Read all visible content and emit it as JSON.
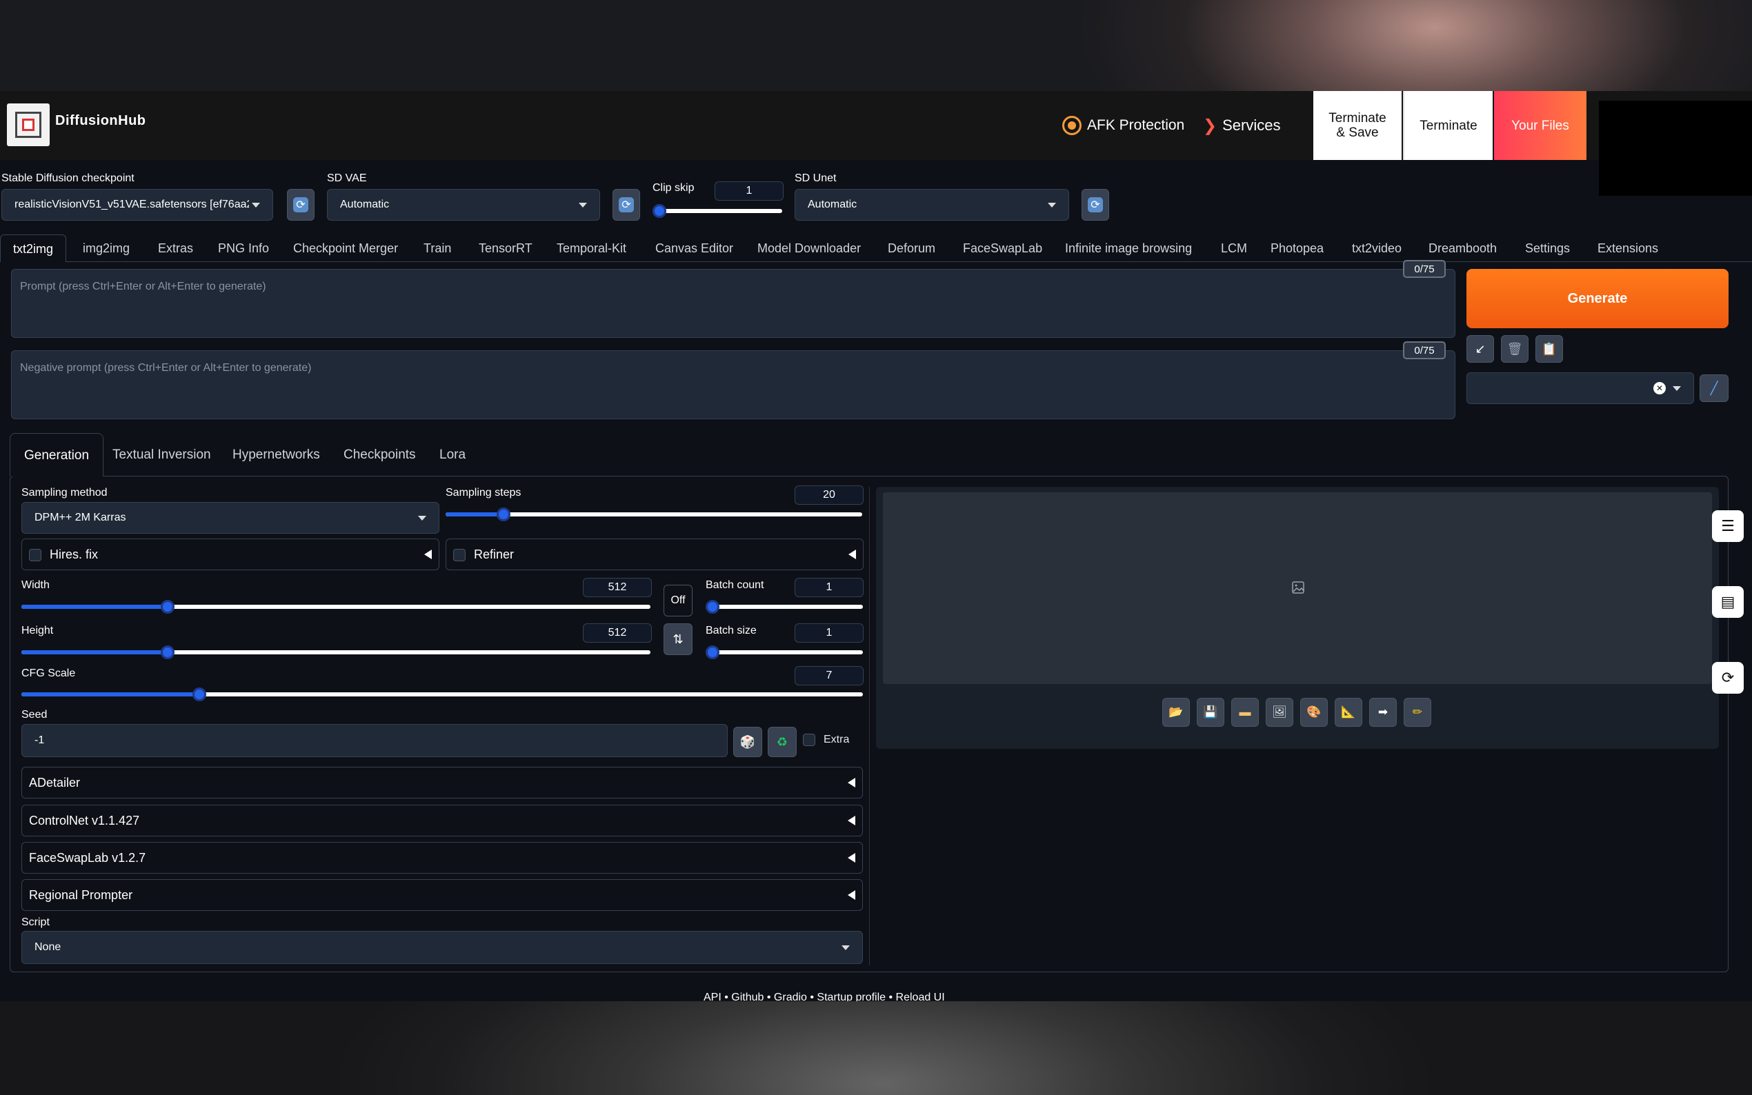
{
  "header": {
    "brand": "DiffusionHub",
    "afk_label": "AFK Protection",
    "services_label": "Services",
    "terminate_save_label": "Terminate & Save",
    "terminate_label": "Terminate",
    "your_files_label": "Your Files"
  },
  "settings": {
    "checkpoint_label": "Stable Diffusion checkpoint",
    "checkpoint_value": "realisticVisionV51_v51VAE.safetensors [ef76aa2",
    "vae_label": "SD VAE",
    "vae_value": "Automatic",
    "clip_skip_label": "Clip skip",
    "clip_skip_value": "1",
    "unet_label": "SD Unet",
    "unet_value": "Automatic"
  },
  "tabs": [
    "txt2img",
    "img2img",
    "Extras",
    "PNG Info",
    "Checkpoint Merger",
    "Train",
    "TensorRT",
    "Temporal-Kit",
    "Canvas Editor",
    "Model Downloader",
    "Deforum",
    "FaceSwapLab",
    "Infinite image browsing",
    "LCM",
    "Photopea",
    "txt2video",
    "Dreambooth",
    "Settings",
    "Extensions"
  ],
  "prompt": {
    "placeholder": "Prompt (press Ctrl+Enter or Alt+Enter to generate)",
    "counter": "0/75",
    "negative_placeholder": "Negative prompt (press Ctrl+Enter or Alt+Enter to generate)",
    "negative_counter": "0/75"
  },
  "generate_label": "Generate",
  "subtabs": [
    "Generation",
    "Textual Inversion",
    "Hypernetworks",
    "Checkpoints",
    "Lora"
  ],
  "generation": {
    "sampling_method_label": "Sampling method",
    "sampling_method_value": "DPM++ 2M Karras",
    "sampling_steps_label": "Sampling steps",
    "sampling_steps_value": "20",
    "hires_label": "Hires. fix",
    "refiner_label": "Refiner",
    "width_label": "Width",
    "width_value": "512",
    "height_label": "Height",
    "height_value": "512",
    "off_label": "Off",
    "batch_count_label": "Batch count",
    "batch_count_value": "1",
    "batch_size_label": "Batch size",
    "batch_size_value": "1",
    "cfg_label": "CFG Scale",
    "cfg_value": "7",
    "seed_label": "Seed",
    "seed_value": "-1",
    "extra_label": "Extra",
    "script_label": "Script",
    "script_value": "None"
  },
  "accordions": [
    "ADetailer",
    "ControlNet v1.1.427",
    "FaceSwapLab v1.2.7",
    "Regional Prompter"
  ],
  "footer": "API  •  Github  •  Gradio  •  Startup profile  •  Reload UI",
  "colors": {
    "accent": "#2563eb",
    "generate": "#f97316",
    "bg": "#0d1016"
  },
  "icons": [
    "refresh-icon",
    "arrow-in-icon",
    "trash-icon",
    "clipboard-icon",
    "brush-icon",
    "folder-icon",
    "save-icon",
    "zip-icon",
    "image-icon",
    "palette-icon",
    "ruler-icon",
    "send-icon",
    "pencil-icon",
    "menu-icon",
    "document-icon",
    "reload-icon"
  ]
}
